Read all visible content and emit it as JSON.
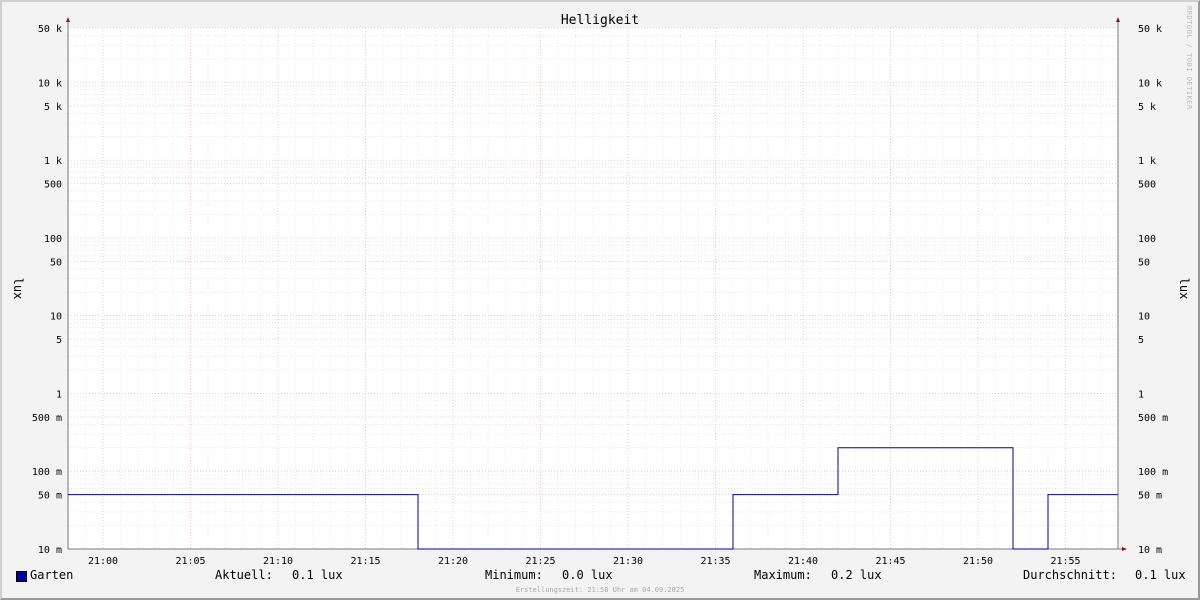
{
  "chart_data": {
    "type": "line",
    "title": "Helligkeit",
    "ylabel": "lux",
    "y_scale": "log",
    "ylim": [
      0.01,
      50000
    ],
    "grid": true,
    "x_tick_labels": [
      "21:00",
      "21:05",
      "21:10",
      "21:15",
      "21:20",
      "21:25",
      "21:30",
      "21:35",
      "21:40",
      "21:45",
      "21:50",
      "21:55"
    ],
    "y_tick_labels": [
      {
        "value": 50000,
        "label": "50 k"
      },
      {
        "value": 10000,
        "label": "10 k"
      },
      {
        "value": 5000,
        "label": "5 k"
      },
      {
        "value": 1000,
        "label": "1 k"
      },
      {
        "value": 500,
        "label": "500"
      },
      {
        "value": 100,
        "label": "100"
      },
      {
        "value": 50,
        "label": "50"
      },
      {
        "value": 10,
        "label": "10"
      },
      {
        "value": 5,
        "label": "5"
      },
      {
        "value": 1,
        "label": "1"
      },
      {
        "value": 0.5,
        "label": "500 m"
      },
      {
        "value": 0.1,
        "label": "100 m"
      },
      {
        "value": 0.05,
        "label": "50 m"
      },
      {
        "value": 0.01,
        "label": "10 m"
      }
    ],
    "series": [
      {
        "name": "Garten",
        "color": "#00009c",
        "points": [
          {
            "x": "20:58",
            "y": 0.05
          },
          {
            "x": "21:18",
            "y": 0.05
          },
          {
            "x": "21:18",
            "y": 0.01
          },
          {
            "x": "21:36",
            "y": 0.01
          },
          {
            "x": "21:36",
            "y": 0.05
          },
          {
            "x": "21:42",
            "y": 0.05
          },
          {
            "x": "21:42",
            "y": 0.2
          },
          {
            "x": "21:52",
            "y": 0.2
          },
          {
            "x": "21:52",
            "y": 0.01
          },
          {
            "x": "21:54",
            "y": 0.01
          },
          {
            "x": "21:54",
            "y": 0.05
          },
          {
            "x": "21:58",
            "y": 0.05
          }
        ]
      }
    ]
  },
  "side_credit": "RRDTOOL / TOBI OETIKER",
  "legend": {
    "series_name": "Garten",
    "series_color": "#00009c",
    "current_label": "Aktuell:",
    "current_value": "0.1 lux",
    "min_label": "Minimum:",
    "min_value": "0.0 lux",
    "max_label": "Maximum:",
    "max_value": "0.2 lux",
    "avg_label": "Durchschnitt:",
    "avg_value": "0.1 lux"
  },
  "footer": "Erstellungszeit: 21:58 Uhr am 04.09.2025"
}
